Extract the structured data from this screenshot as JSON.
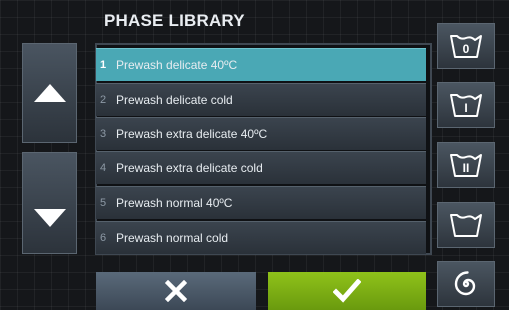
{
  "header": {
    "title": "PHASE LIBRARY"
  },
  "phases": [
    {
      "index": "1",
      "label": "Prewash delicate 40ºC",
      "selected": true
    },
    {
      "index": "2",
      "label": "Prewash delicate cold",
      "selected": false
    },
    {
      "index": "3",
      "label": "Prewash extra delicate 40ºC",
      "selected": false
    },
    {
      "index": "4",
      "label": "Prewash extra delicate cold",
      "selected": false
    },
    {
      "index": "5",
      "label": "Prewash normal 40ºC",
      "selected": false
    },
    {
      "index": "6",
      "label": "Prewash normal cold",
      "selected": false
    }
  ],
  "side_buttons": [
    {
      "icon": "tub-0-icon",
      "mark": "0"
    },
    {
      "icon": "tub-i-icon",
      "mark": "I"
    },
    {
      "icon": "tub-ii-icon",
      "mark": "II"
    },
    {
      "icon": "tub-empty-icon",
      "mark": ""
    },
    {
      "icon": "spiral-icon",
      "mark": ""
    }
  ],
  "nav": {
    "up_icon": "arrow-up-icon",
    "down_icon": "arrow-down-icon"
  },
  "footer": {
    "cancel_icon": "close-icon",
    "confirm_icon": "checkmark-icon"
  },
  "colors": {
    "background": "#15171a",
    "selected_row": "#4aa8b5",
    "confirm": "#8fc21a",
    "cancel": "#4c5a68"
  }
}
